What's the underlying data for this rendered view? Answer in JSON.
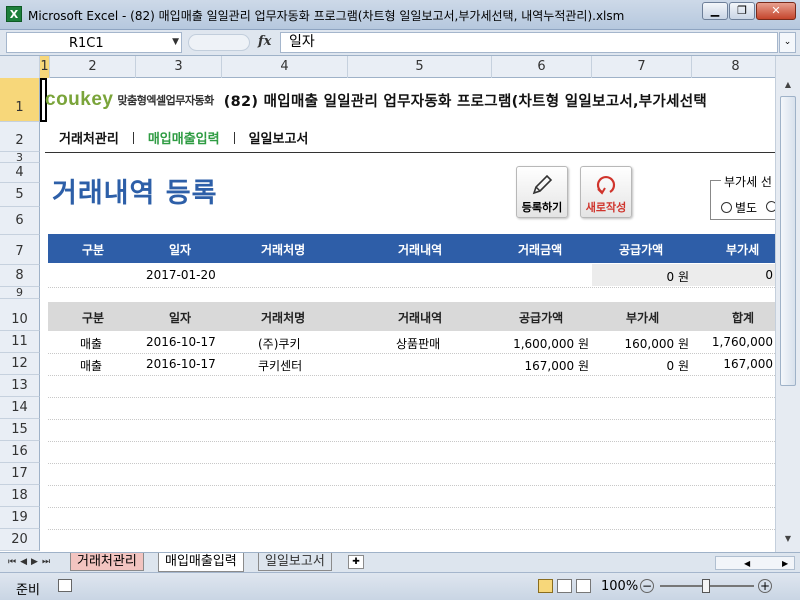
{
  "window": {
    "app_icon": "excel-icon",
    "title": "Microsoft Excel - (82) 매입매출 일일관리 업무자동화 프로그램(차트형 일일보고서,부가세선택, 내역누적관리).xlsm"
  },
  "formula_bar": {
    "name_box": "R1C1",
    "fx_label": "fx",
    "value": "일자"
  },
  "columns": [
    "1",
    "2",
    "3",
    "4",
    "5",
    "6",
    "7",
    "8"
  ],
  "rows": [
    "1",
    "2",
    "3",
    "4",
    "5",
    "6",
    "7",
    "8",
    "9",
    "10",
    "11",
    "12",
    "13",
    "14",
    "15",
    "16",
    "17",
    "18",
    "19",
    "20"
  ],
  "banner": {
    "logo": "coukey",
    "logo_sub": "맞춤형엑셀업무자동화",
    "title": "(82) 매입매출 일일관리 업무자동화 프로그램(차트형 일일보고서,부가세선택"
  },
  "nav": {
    "items": [
      "거래처관리",
      "매입매출입력",
      "일일보고서"
    ],
    "active": "매입매출입력",
    "active_color": "#2f9c43"
  },
  "page_heading": "거래내역 등록",
  "buttons": {
    "register": "등록하기",
    "new_entry": "새로작성"
  },
  "vat": {
    "legend": "부가세 선",
    "option_separate": "별도"
  },
  "entry_table": {
    "headers": [
      "구분",
      "일자",
      "거래처명",
      "거래내역",
      "거래금액",
      "공급가액",
      "부가세"
    ],
    "row": {
      "type": "",
      "date": "2017-01-20",
      "client": "",
      "detail": "",
      "amount": "",
      "supply": "0 원",
      "vat": "0"
    },
    "header_color": "#2e5ea8"
  },
  "records_table": {
    "headers": [
      "구분",
      "일자",
      "거래처명",
      "거래내역",
      "공급가액",
      "부가세",
      "합계"
    ],
    "rows": [
      {
        "type": "매출",
        "date": "2016-10-17",
        "client": "(주)쿠키",
        "detail": "상품판매",
        "supply": "1,600,000 원",
        "vat": "160,000 원",
        "total": "1,760,000"
      },
      {
        "type": "매출",
        "date": "2016-10-17",
        "client": "쿠키센터",
        "detail": "",
        "supply": "167,000 원",
        "vat": "0 원",
        "total": "167,000"
      }
    ]
  },
  "sheet_tabs": [
    "거래처관리",
    "매입매출입력",
    "일일보고서"
  ],
  "status": {
    "ready": "준비",
    "zoom": "100%"
  }
}
